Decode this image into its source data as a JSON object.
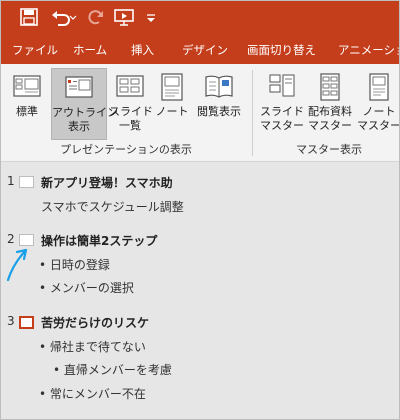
{
  "colors": {
    "accent": "#c43e1c",
    "ribbon_bg": "#f3f3f3",
    "pane_bg": "#e6e6e6",
    "arrow": "#1aa0e8"
  },
  "quick_access": {
    "qat_icons": [
      "save-icon",
      "undo-icon",
      "redo-icon",
      "present-from-start-icon",
      "customize-qat-icon"
    ]
  },
  "tabs": [
    "ファイル",
    "ホーム",
    "挿入",
    "デザイン",
    "画面切り替え",
    "アニメーション"
  ],
  "ribbon": {
    "presentation_views": [
      {
        "label": "標準",
        "icon": "normal-view-icon"
      },
      {
        "label": "アウトライン\n表示",
        "icon": "outline-view-icon",
        "active": true
      },
      {
        "label": "スライド\n一覧",
        "icon": "slide-sorter-icon"
      },
      {
        "label": "ノート",
        "icon": "notes-page-icon"
      },
      {
        "label": "閲覧表示",
        "icon": "reading-view-icon"
      }
    ],
    "presentation_views_group": "プレゼンテーションの表示",
    "master_views": [
      {
        "label": "スライド\nマスター",
        "icon": "slide-master-icon"
      },
      {
        "label": "配布資料\nマスター",
        "icon": "handout-master-icon"
      },
      {
        "label": "ノート\nマスター",
        "icon": "notes-master-icon"
      }
    ],
    "master_views_group": "マスター表示"
  },
  "outline": {
    "slides": [
      {
        "number": "1",
        "title": "新アプリ登場！スマホ助",
        "body": [
          "スマホでスケジュール調整"
        ]
      },
      {
        "number": "2",
        "title": "操作は簡単2ステップ",
        "body": [
          "• 日時の登録",
          "• メンバーの選択"
        ]
      },
      {
        "number": "3",
        "title": "苦労だらけのリスケ",
        "body": [
          "• 帰社まで待てない",
          "• 直帰メンバーを考慮",
          "• 常にメンバー不在"
        ]
      }
    ]
  }
}
